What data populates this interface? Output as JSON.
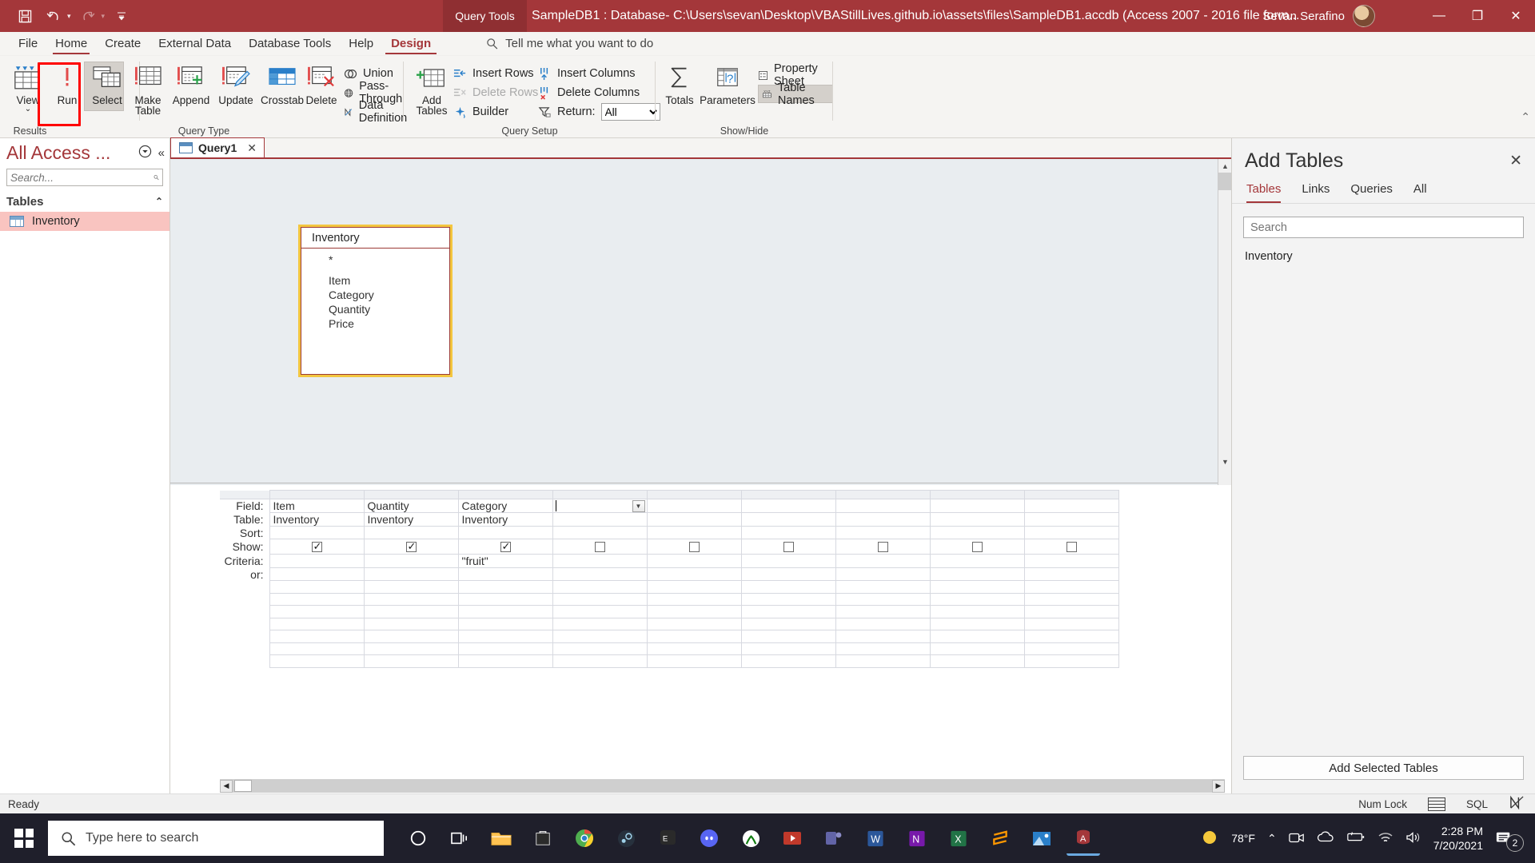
{
  "titlebar": {
    "quick_access": [
      "save-icon",
      "undo-icon",
      "redo-icon",
      "customize-qat-icon"
    ],
    "context_tab_label": "Query Tools",
    "document_title": "SampleDB1 : Database- C:\\Users\\sevan\\Desktop\\VBAStillLives.github.io\\assets\\files\\SampleDB1.accdb (Access 2007 - 2016 file form...",
    "user_name": "Sevan Serafino",
    "minimize": "—",
    "restore": "❐",
    "close": "✕"
  },
  "menu": {
    "tabs": [
      {
        "label": "File"
      },
      {
        "label": "Home"
      },
      {
        "label": "Create"
      },
      {
        "label": "External Data"
      },
      {
        "label": "Database Tools"
      },
      {
        "label": "Help"
      },
      {
        "label": "Design"
      }
    ],
    "tell_me": "Tell me what you want to do"
  },
  "ribbon": {
    "groups": [
      {
        "name": "Results",
        "label": "Results"
      },
      {
        "name": "Query Type",
        "label": "Query Type"
      },
      {
        "name": "Query Setup",
        "label": "Query Setup"
      },
      {
        "name": "Show/Hide",
        "label": "Show/Hide"
      }
    ],
    "view": "View",
    "run": "Run",
    "select": "Select",
    "make_table": "Make\nTable",
    "make_table_l1": "Make",
    "make_table_l2": "Table",
    "append": "Append",
    "update": "Update",
    "crosstab": "Crosstab",
    "delete": "Delete",
    "union": "Union",
    "pass_through": "Pass-Through",
    "data_definition": "Data Definition",
    "add_tables_l1": "Add",
    "add_tables_l2": "Tables",
    "insert_rows": "Insert Rows",
    "delete_rows": "Delete Rows",
    "builder": "Builder",
    "insert_columns": "Insert Columns",
    "delete_columns": "Delete Columns",
    "return_label": "Return:",
    "return_value": "All",
    "totals": "Totals",
    "parameters": "Parameters",
    "property_sheet": "Property Sheet",
    "table_names": "Table Names"
  },
  "navpane": {
    "title": "All Access ...",
    "search_placeholder": "Search...",
    "group_label": "Tables",
    "items": [
      {
        "label": "Inventory",
        "icon": "table-icon",
        "selected": true
      }
    ]
  },
  "designer": {
    "tab_label": "Query1",
    "tab_close": "✕",
    "table_box": {
      "title": "Inventory",
      "fields": [
        "*",
        "Item",
        "Category",
        "Quantity",
        "Price"
      ],
      "border_color": "#9c3a36",
      "selection_color": "#f3c63f"
    }
  },
  "grid": {
    "row_labels": [
      "Field:",
      "Table:",
      "Sort:",
      "Show:",
      "Criteria:",
      "or:"
    ],
    "columns": [
      {
        "field": "Item",
        "table": "Inventory",
        "sort": "",
        "show": true,
        "criteria": "",
        "or": ""
      },
      {
        "field": "Quantity",
        "table": "Inventory",
        "sort": "",
        "show": true,
        "criteria": "",
        "or": ""
      },
      {
        "field": "Category",
        "table": "Inventory",
        "sort": "",
        "show": true,
        "criteria": "\"fruit\"",
        "or": ""
      },
      {
        "field": "",
        "table": "",
        "sort": "",
        "show": false,
        "criteria": "",
        "or": "",
        "active": true
      },
      {
        "field": "",
        "table": "",
        "sort": "",
        "show": false,
        "criteria": "",
        "or": ""
      },
      {
        "field": "",
        "table": "",
        "sort": "",
        "show": false,
        "criteria": "",
        "or": ""
      },
      {
        "field": "",
        "table": "",
        "sort": "",
        "show": false,
        "criteria": "",
        "or": ""
      },
      {
        "field": "",
        "table": "",
        "sort": "",
        "show": false,
        "criteria": "",
        "or": ""
      },
      {
        "field": "",
        "table": "",
        "sort": "",
        "show": false,
        "criteria": "",
        "or": ""
      }
    ]
  },
  "add_tables": {
    "title": "Add Tables",
    "close": "✕",
    "tabs": [
      "Tables",
      "Links",
      "Queries",
      "All"
    ],
    "active_tab": "Tables",
    "search_placeholder": "Search",
    "items": [
      "Inventory"
    ],
    "add_button": "Add Selected Tables"
  },
  "statusbar": {
    "status": "Ready",
    "num_lock": "Num Lock",
    "view_datasheet": "datasheet-view-icon",
    "view_sql": "SQL",
    "view_design": "design-view-icon"
  },
  "taskbar": {
    "search_placeholder": "Type here to search",
    "weather_temp": "78°F",
    "time": "2:28 PM",
    "date": "7/20/2021",
    "notification_count": "2",
    "apps": [
      "cortana-icon",
      "task-view-icon",
      "file-explorer-icon",
      "store-icon",
      "chrome-icon",
      "steam-icon",
      "epic-games-icon",
      "discord-icon",
      "xbox-icon",
      "video-editor-icon",
      "teams-icon",
      "word-icon",
      "onenote-icon",
      "excel-icon",
      "sublime-icon",
      "photos-icon",
      "access-icon"
    ]
  },
  "colors": {
    "accent": "#a4373a",
    "context_tab": "#8f2f32",
    "highlight_box": "#ff0000",
    "selection": "#f9c4c0",
    "canvas": "#e9edf0"
  }
}
